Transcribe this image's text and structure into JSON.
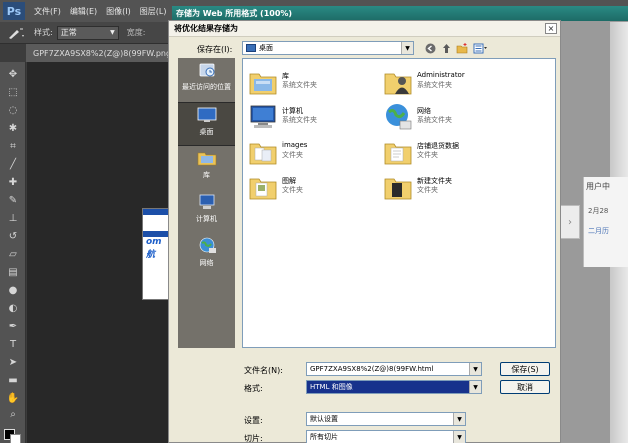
{
  "photoshop": {
    "logo": "Ps",
    "menu": [
      "文件(F)",
      "编辑(E)",
      "图像(I)",
      "图层(L)"
    ],
    "options": {
      "style_label": "样式:",
      "style_value": "正常",
      "width_label": "宽度:"
    },
    "doc_tab": "GPF7ZXA9SX8%2(Z@)8(99FW.png @"
  },
  "save_for_web": {
    "title": "存储为 Web 所用格式 (100%)",
    "right_text": "用户中",
    "date_text": "2月28",
    "date_text2": "二月历"
  },
  "dialog": {
    "title": "将优化结果存储为",
    "close": "×",
    "save_in_label": "保存在(I):",
    "save_in_value": "桌面",
    "places": [
      {
        "label": "最近访问的位置",
        "icon": "recent-places-icon"
      },
      {
        "label": "桌面",
        "icon": "desktop-icon"
      },
      {
        "label": "库",
        "icon": "library-icon"
      },
      {
        "label": "计算机",
        "icon": "computer-icon"
      },
      {
        "label": "网络",
        "icon": "network-icon"
      }
    ],
    "files": [
      {
        "name": "库",
        "type": "系统文件夹",
        "icon": "library-folder-icon"
      },
      {
        "name": "Administrator",
        "type": "系统文件夹",
        "icon": "user-folder-icon"
      },
      {
        "name": "计算机",
        "type": "系统文件夹",
        "icon": "computer-icon"
      },
      {
        "name": "网络",
        "type": "系统文件夹",
        "icon": "network-icon"
      },
      {
        "name": "images",
        "type": "文件夹",
        "icon": "folder-icon"
      },
      {
        "name": "店铺退货数据",
        "type": "文件夹",
        "icon": "folder-icon"
      },
      {
        "name": "图解",
        "type": "文件夹",
        "icon": "folder-icon"
      },
      {
        "name": "新建文件夹",
        "type": "文件夹",
        "icon": "folder-icon"
      }
    ],
    "filename_label": "文件名(N):",
    "filename_value": "GPF7ZXA9SX8%2(Z@)8(99FW.html",
    "format_label": "格式:",
    "format_value": "HTML 和图像",
    "save_button": "保存(S)",
    "cancel_button": "取消",
    "settings_label": "设置:",
    "settings_value": "默认设置",
    "slices_label": "切片:",
    "slices_value": "所有切片"
  },
  "colors": {
    "ps_bg": "#535353",
    "sfw_title": "#1d6b66",
    "selection": "#17328c",
    "places_bg": "#74716a"
  }
}
